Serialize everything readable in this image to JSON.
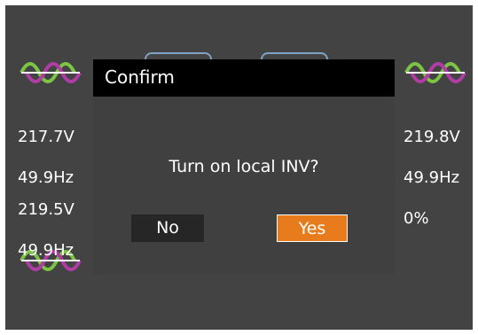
{
  "dialog": {
    "title": "Confirm",
    "message": "Turn on local INV?",
    "no_label": "No",
    "yes_label": "Yes"
  },
  "readouts": {
    "left_top": {
      "voltage": "217.7V",
      "frequency": "49.9Hz"
    },
    "left_bottom": {
      "voltage": "219.5V",
      "frequency": "49.9Hz"
    },
    "right": {
      "voltage": "219.8V",
      "frequency": "49.9Hz",
      "percent": "0%"
    }
  },
  "colors": {
    "background": "#434343",
    "title_bar": "#000000",
    "yes_button": "#e87c1c",
    "no_button": "#262626",
    "wave_green": "#7cc443",
    "wave_purple": "#b23ca6"
  },
  "icons": [
    "sine-wave-icon"
  ]
}
